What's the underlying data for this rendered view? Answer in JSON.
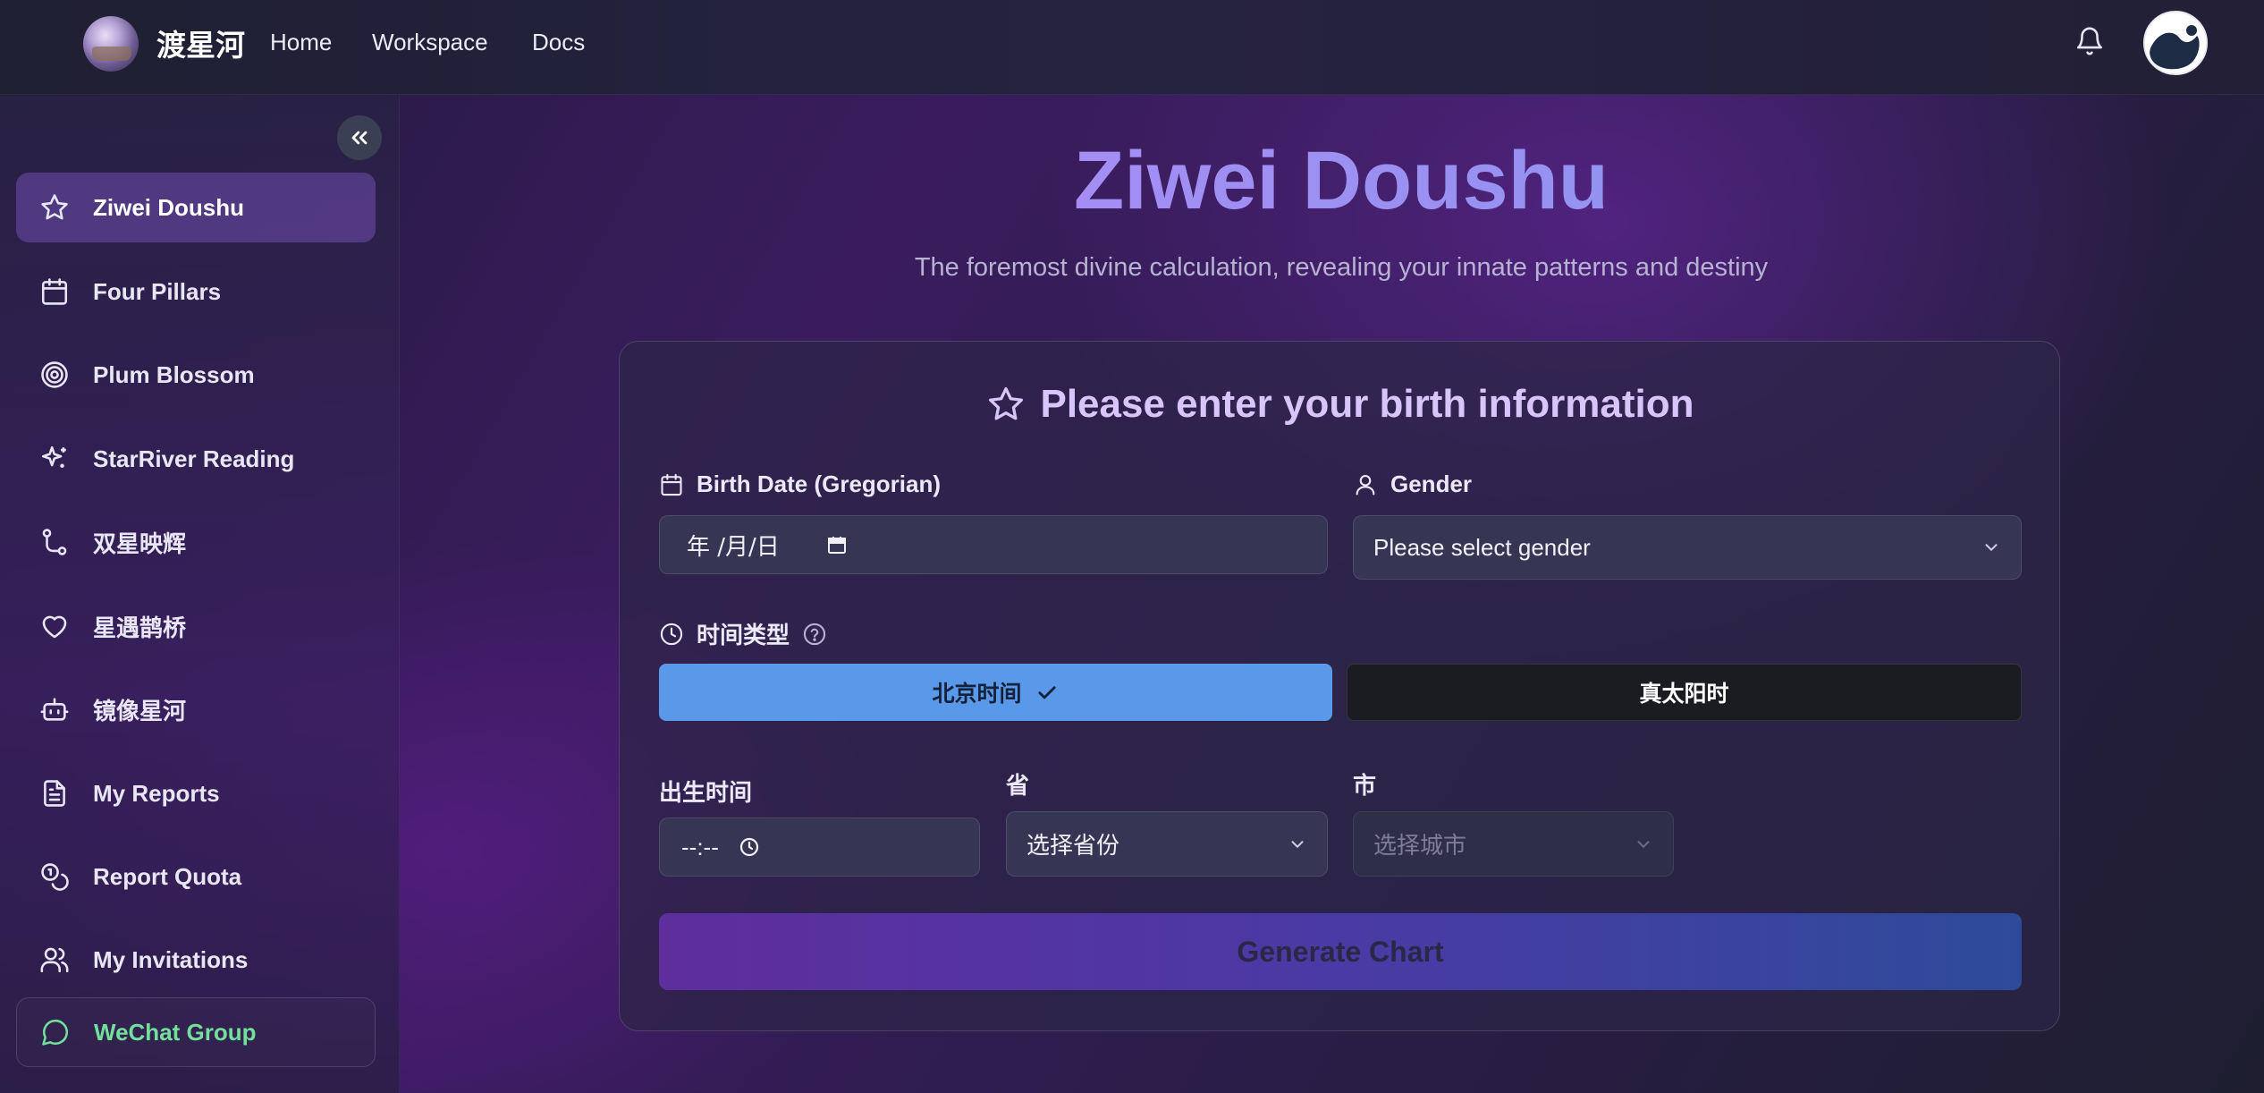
{
  "navbar": {
    "brand": "渡星河",
    "links": [
      "Home",
      "Workspace",
      "Docs"
    ]
  },
  "sidebar": {
    "items": [
      {
        "label": "Ziwei Doushu",
        "icon": "star-icon",
        "active": true
      },
      {
        "label": "Four Pillars",
        "icon": "calendar-icon"
      },
      {
        "label": "Plum Blossom",
        "icon": "target-icon"
      },
      {
        "label": "StarRiver Reading",
        "icon": "sparkles-icon"
      },
      {
        "label": "双星映辉",
        "icon": "git-branch-icon"
      },
      {
        "label": "星遇鹊桥",
        "icon": "heart-icon"
      },
      {
        "label": "镜像星河",
        "icon": "bot-icon"
      },
      {
        "label": "My Reports",
        "icon": "file-text-icon"
      },
      {
        "label": "Report Quota",
        "icon": "coins-icon"
      },
      {
        "label": "My Invitations",
        "icon": "users-icon"
      },
      {
        "label": "WeChat Group",
        "icon": "message-circle-icon"
      }
    ]
  },
  "main": {
    "title": "Ziwei Doushu",
    "subtitle": "The foremost divine calculation, revealing your innate patterns and destiny"
  },
  "form": {
    "title": "Please enter your birth information",
    "birth_date_label": "Birth Date (Gregorian)",
    "birth_date_value": "年 /月/日",
    "gender_label": "Gender",
    "gender_placeholder": "Please select gender",
    "time_type_label": "时间类型",
    "time_type_options": [
      "北京时间",
      "真太阳时"
    ],
    "time_type_selected": "北京时间",
    "birth_time_label": "出生时间",
    "birth_time_value": "--:--",
    "province_label": "省",
    "province_placeholder": "选择省份",
    "city_label": "市",
    "city_placeholder": "选择城市",
    "submit_label": "Generate Chart"
  },
  "colors": {
    "accent": "#5a98ea",
    "title": "#9b88f2",
    "wechat": "#72e09a"
  }
}
